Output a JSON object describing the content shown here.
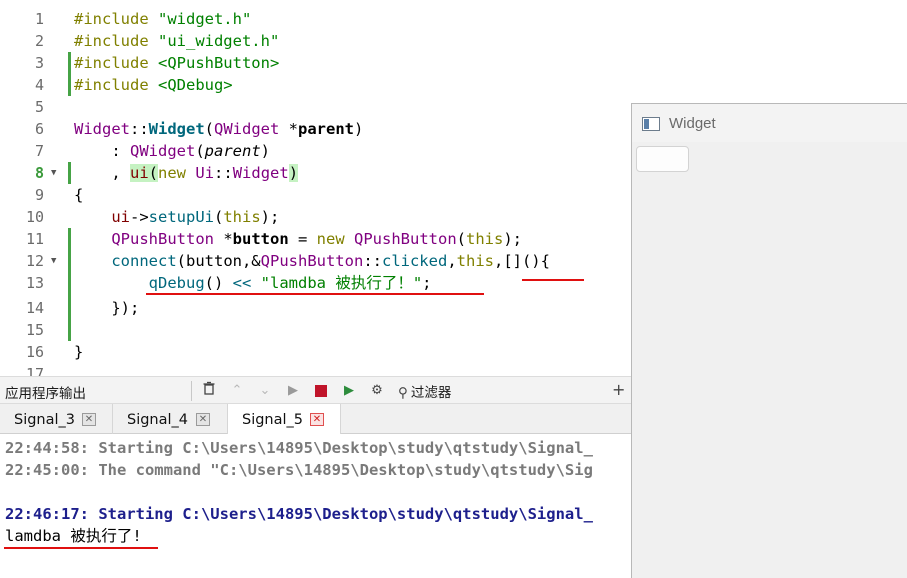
{
  "editor": {
    "line_numbers": [
      "1",
      "2",
      "3",
      "4",
      "5",
      "6",
      "7",
      "8",
      "9",
      "10",
      "11",
      "12",
      "13",
      "14",
      "15",
      "16",
      "17"
    ],
    "current_line": "8",
    "lines": {
      "l1": {
        "kw": "#include",
        "str": " \"widget.h\""
      },
      "l2": {
        "kw": "#include",
        "str": " \"ui_widget.h\""
      },
      "l3": {
        "kw": "#include",
        "str": " <QPushButton>"
      },
      "l4": {
        "kw": "#include",
        "str": " <QDebug>"
      },
      "l6": {
        "cls1": "Widget",
        "sep": "::",
        "fn": "Widget",
        "p1": "(",
        "cls2": "QWidget",
        "sp": " *",
        "param": "parent",
        "p2": ")"
      },
      "l7": {
        "pre": "    : ",
        "cls": "QWidget",
        "p1": "(",
        "param": "parent",
        "p2": ")"
      },
      "l8": {
        "pre": "    , ",
        "mem": "ui",
        "p1": "(",
        "kw": "new",
        "sp": " ",
        "cls": "Ui",
        "sep": "::",
        "cls2": "Widget",
        "p2": ")"
      },
      "l9": "{",
      "l10": {
        "pre": "    ",
        "mem": "ui",
        "arrow": "->",
        "fn": "setupUi",
        "p1": "(",
        "kw": "this",
        "p2": ");"
      },
      "l11": {
        "pre": "    ",
        "cls": "QPushButton",
        "sp": " *",
        "var": "button",
        "eq": " = ",
        "kw": "new",
        "sp2": " ",
        "cls2": "QPushButton",
        "p1": "(",
        "kw2": "this",
        "p2": ");"
      },
      "l12": {
        "pre": "    ",
        "fn": "connect",
        "p1": "(button,&",
        "cls": "QPushButton",
        "sep": "::",
        "fn2": "clicked",
        "comma": ",",
        "kw": "this",
        "rest": ",[](){"
      },
      "l13": {
        "pre": "        ",
        "fn": "qDebug",
        "p1": "() ",
        "op": "<<",
        "sp": " ",
        "str": "\"lamdba 被执行了！\"",
        "end": ";"
      },
      "l14": "    });",
      "l16": "}"
    }
  },
  "output_pane": {
    "title": "应用程序输出",
    "filter_label": "过滤器",
    "tabs": [
      {
        "label": "Signal_3"
      },
      {
        "label": "Signal_4"
      },
      {
        "label": "Signal_5"
      }
    ],
    "lines": [
      "22:44:58: Starting C:\\Users\\14895\\Desktop\\study\\qtstudy\\Signal_",
      "22:45:00: The command \"C:\\Users\\14895\\Desktop\\study\\qtstudy\\Sig",
      "",
      "22:46:17: Starting C:\\Users\\14895\\Desktop\\study\\qtstudy\\Signal_",
      "lamdba 被执行了!"
    ]
  },
  "widget_window": {
    "title": "Widget"
  },
  "toolbar_icons": [
    "trash-icon",
    "up-icon",
    "down-icon",
    "run-icon",
    "stop-icon",
    "debug-run-icon",
    "settings-icon",
    "search-icon"
  ],
  "colors": {
    "keyword": "#808000",
    "string": "#008000",
    "class": "#800080",
    "function": "#00677c",
    "annotation": "#e01010",
    "output_blue": "#1d1f8c"
  }
}
